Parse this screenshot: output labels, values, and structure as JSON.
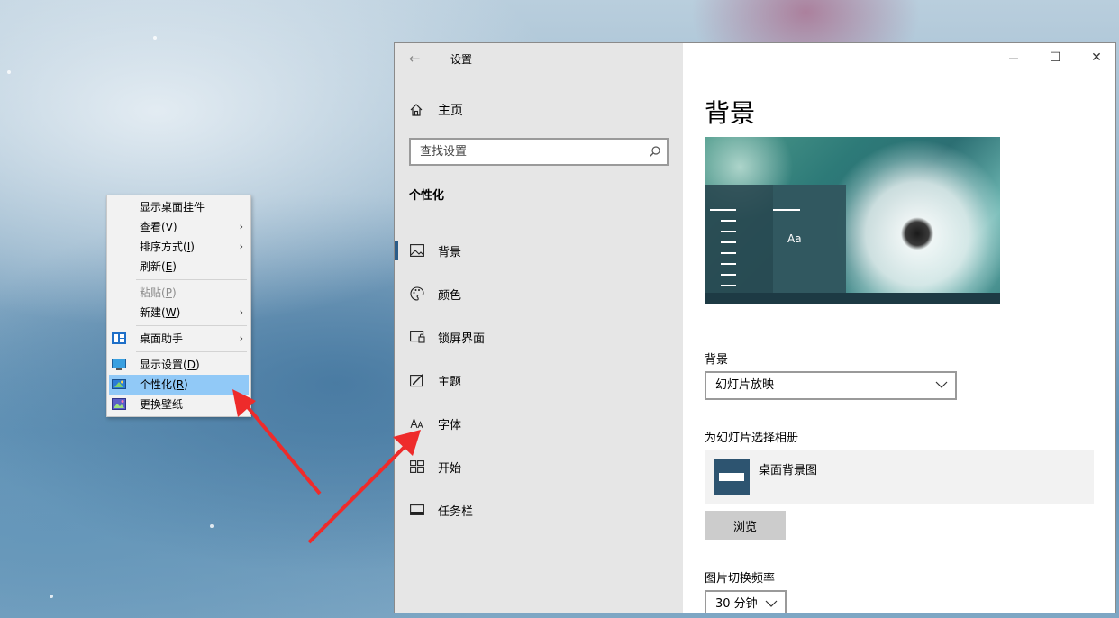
{
  "context_menu": {
    "items": [
      {
        "label": "显示桌面挂件",
        "key": "",
        "submenu": false,
        "disabled": false,
        "icon": ""
      },
      {
        "label": "查看",
        "key": "V",
        "submenu": true,
        "disabled": false,
        "icon": ""
      },
      {
        "label": "排序方式",
        "key": "I",
        "submenu": true,
        "disabled": false,
        "icon": ""
      },
      {
        "label": "刷新",
        "key": "E",
        "submenu": false,
        "disabled": false,
        "icon": ""
      },
      {
        "label": "粘贴",
        "key": "P",
        "submenu": false,
        "disabled": true,
        "icon": ""
      },
      {
        "label": "新建",
        "key": "W",
        "submenu": true,
        "disabled": false,
        "icon": ""
      },
      {
        "label": "桌面助手",
        "key": "",
        "submenu": true,
        "disabled": false,
        "icon": "desktop-assistant-icon"
      },
      {
        "label": "显示设置",
        "key": "D",
        "submenu": false,
        "disabled": false,
        "icon": "display-settings-icon"
      },
      {
        "label": "个性化",
        "key": "R",
        "submenu": false,
        "disabled": false,
        "icon": "personalize-icon",
        "active": true
      },
      {
        "label": "更换壁纸",
        "key": "",
        "submenu": false,
        "disabled": false,
        "icon": "wallpaper-icon"
      }
    ],
    "submenu_arrow": "›"
  },
  "window": {
    "back_glyph": "←",
    "title": "设置",
    "controls": {
      "minimize": "—",
      "maximize": "☐",
      "close": "✕"
    }
  },
  "sidebar": {
    "home_label": "主页",
    "search_placeholder": "查找设置",
    "section_title": "个性化",
    "items": [
      {
        "label": "背景",
        "icon": "background-image-icon",
        "selected": true
      },
      {
        "label": "颜色",
        "icon": "palette-icon"
      },
      {
        "label": "锁屏界面",
        "icon": "lock-screen-icon"
      },
      {
        "label": "主题",
        "icon": "theme-brush-icon"
      },
      {
        "label": "字体",
        "icon": "font-icon"
      },
      {
        "label": "开始",
        "icon": "start-grid-icon"
      },
      {
        "label": "任务栏",
        "icon": "taskbar-icon"
      }
    ]
  },
  "content": {
    "page_title": "背景",
    "preview_text": "Aa",
    "background_label": "背景",
    "background_value": "幻灯片放映",
    "album_label": "为幻灯片选择相册",
    "album_name": "桌面背景图",
    "browse_button": "浏览",
    "interval_label": "图片切换频率",
    "interval_value": "30 分钟"
  },
  "colors": {
    "accent": "#2b5c88",
    "menu_highlight": "#91c9f7",
    "annotation_arrow": "#ee2b2b",
    "sidebar_bg": "#e6e6e6"
  }
}
